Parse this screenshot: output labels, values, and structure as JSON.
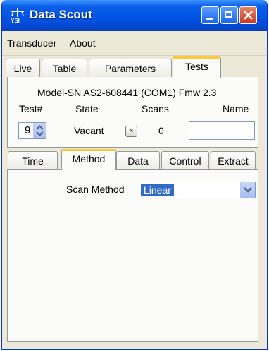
{
  "window": {
    "title": "Data Scout",
    "icon_name": "ysi-logo-icon",
    "accent_color": "#0054e3",
    "close_color": "#c4391b"
  },
  "menu": {
    "items": [
      "Transducer",
      "About"
    ]
  },
  "top_tabs": [
    {
      "label": "Live",
      "active": false
    },
    {
      "label": "Table",
      "active": false
    },
    {
      "label": "Parameters",
      "active": false
    },
    {
      "label": "Tests",
      "active": true
    }
  ],
  "device": {
    "info": "Model-SN AS2-608441 (COM1) Fmw 2.3"
  },
  "test_table": {
    "headers": [
      "Test#",
      "State",
      "Scans",
      "Name"
    ],
    "test_number": "9",
    "state": "Vacant",
    "state_button": "×",
    "scans": "0",
    "name_value": ""
  },
  "bottom_tabs": [
    {
      "label": "Time",
      "active": false
    },
    {
      "label": "Method",
      "active": true
    },
    {
      "label": "Data",
      "active": false
    },
    {
      "label": "Control",
      "active": false
    },
    {
      "label": "Extract",
      "active": false
    }
  ],
  "method": {
    "scan_method_label": "Scan Method",
    "scan_method_value": "Linear"
  }
}
